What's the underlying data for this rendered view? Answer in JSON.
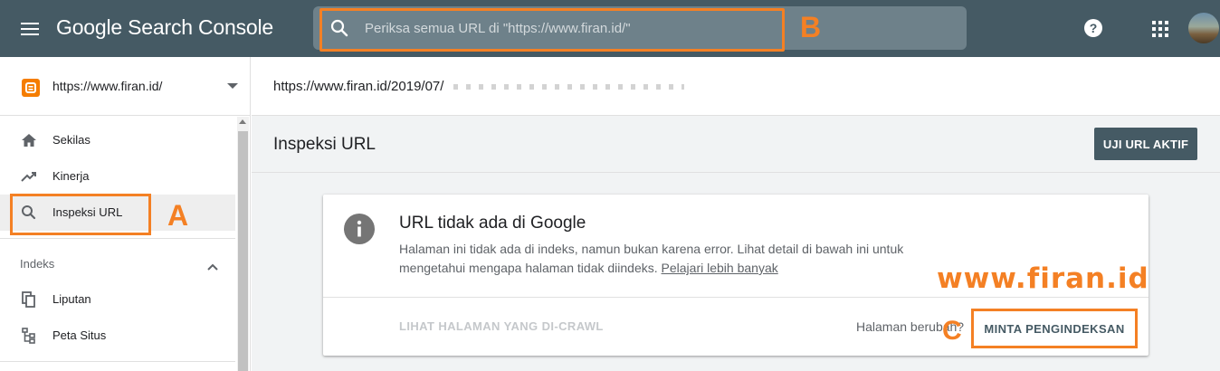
{
  "header": {
    "app_title": "Google Search Console",
    "search_placeholder": "Periksa semua URL di \"https://www.firan.id/\"",
    "annotation_b": "B",
    "icons": [
      "menu-icon",
      "search-icon",
      "help-icon",
      "apps-icon",
      "avatar"
    ]
  },
  "sidebar": {
    "property_url": "https://www.firan.id/",
    "items": [
      {
        "label": "Sekilas",
        "icon": "home-icon"
      },
      {
        "label": "Kinerja",
        "icon": "trending-up-icon"
      },
      {
        "label": "Inspeksi URL",
        "icon": "search-icon",
        "active": true
      }
    ],
    "annotation_a": "A",
    "section_label": "Indeks",
    "section_items": [
      {
        "label": "Liputan",
        "icon": "copy-icon"
      },
      {
        "label": "Peta Situs",
        "icon": "sitemap-icon"
      }
    ]
  },
  "main": {
    "inspected_url": "https://www.firan.id/2019/07/",
    "page_title": "Inspeksi URL",
    "live_test_button": "UJI URL AKTIF",
    "card": {
      "title": "URL tidak ada di Google",
      "description": "Halaman ini tidak ada di indeks, namun bukan karena error. Lihat detail di bawah ini untuk mengetahui mengapa halaman tidak diindeks. ",
      "learn_more": "Pelajari lebih banyak",
      "watermark": "www.firan.id",
      "crawl_link": "LIHAT HALAMAN YANG DI-CRAWL",
      "changed_prompt": "Halaman berubah?",
      "annotation_c": "C",
      "request_index_button": "MINTA PENGINDEKSAN"
    }
  },
  "colors": {
    "topbar": "#455a64",
    "searchbox": "#6e818a",
    "annotation": "#f48024",
    "content_bg": "#f1f3f4",
    "blogger": "#f57d00"
  }
}
